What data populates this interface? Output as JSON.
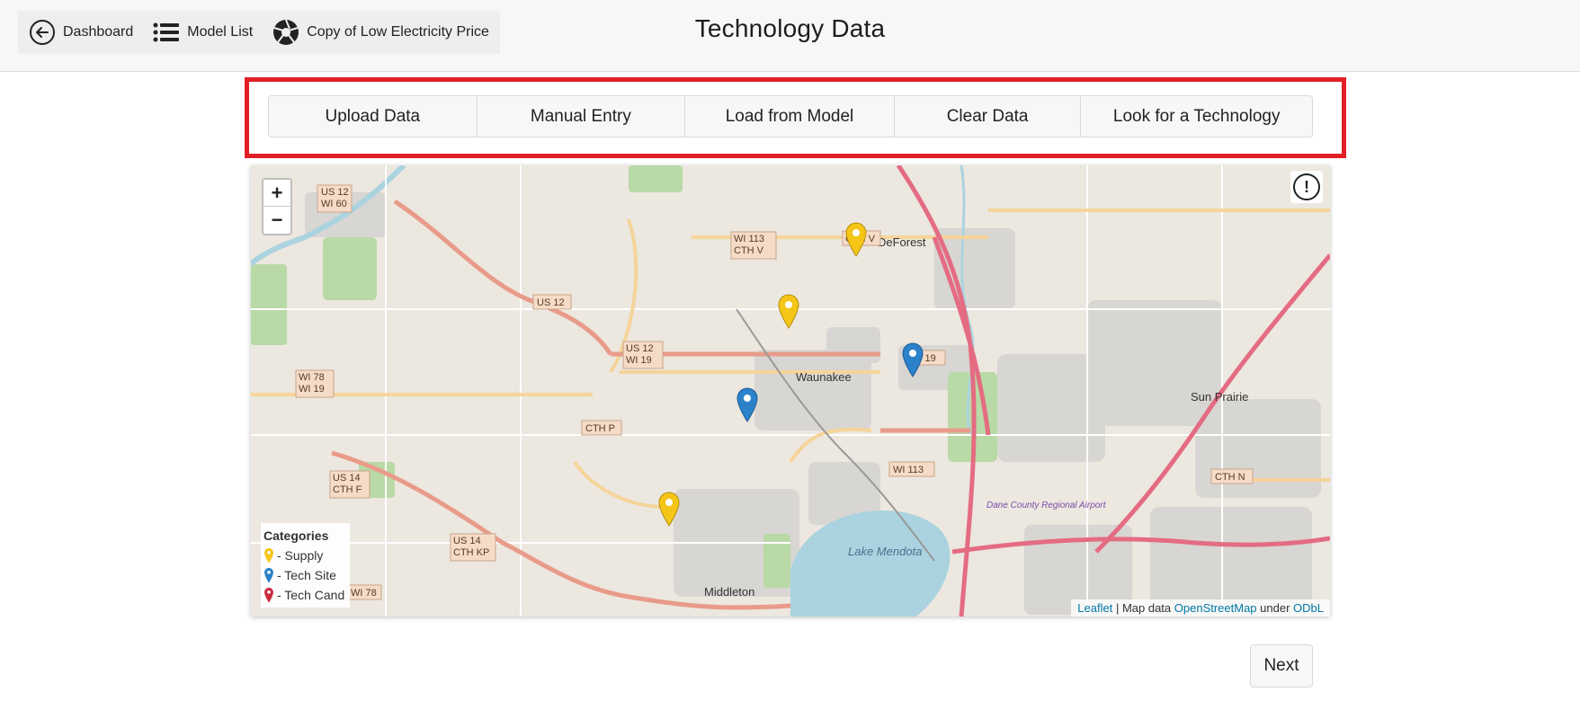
{
  "header": {
    "title": "Technology Data",
    "breadcrumbs": [
      {
        "label": "Dashboard",
        "icon": "back-arrow-circle-icon"
      },
      {
        "label": "Model List",
        "icon": "list-icon"
      },
      {
        "label": "Copy of Low Electricity Price",
        "icon": "aperture-icon"
      }
    ]
  },
  "toolbar": {
    "buttons": [
      {
        "label": "Upload Data"
      },
      {
        "label": "Manual Entry"
      },
      {
        "label": "Load from Model"
      },
      {
        "label": "Clear Data"
      },
      {
        "label": "Look for a Technology"
      }
    ],
    "highlight_color": "#e21f26"
  },
  "map": {
    "zoom_in": "+",
    "zoom_out": "−",
    "info_icon": "!",
    "legend": {
      "title": "Categories",
      "items": [
        {
          "label": "- Supply",
          "color": "#f5c518"
        },
        {
          "label": "- Tech Site",
          "color": "#2b82cb"
        },
        {
          "label": "- Tech Cand",
          "color": "#cb2b3e"
        }
      ]
    },
    "markers": [
      {
        "category": "Supply"
      },
      {
        "category": "Supply"
      },
      {
        "category": "Supply"
      },
      {
        "category": "Tech Site"
      },
      {
        "category": "Tech Site"
      }
    ],
    "place_labels": [
      "DeForest",
      "Waunakee",
      "Sun Prairie",
      "Middleton",
      "Lake Mendota",
      "Dane County Regional Airport"
    ],
    "road_shields": [
      "US 12 WI 60",
      "WI 113 CTH V",
      "CTH V",
      "US 12",
      "US 12 WI 19",
      "WI 19",
      "WI 78 WI 19",
      "CTH P",
      "US 14 CTH F",
      "US 14 CTH KP",
      "WI 78",
      "WI 113",
      "CTH N"
    ],
    "attribution": {
      "leaflet": "Leaflet",
      "sep": " | Map data ",
      "osm": "OpenStreetMap",
      "under": " under ",
      "license": "ODbL"
    }
  },
  "footer": {
    "next_label": "Next"
  }
}
